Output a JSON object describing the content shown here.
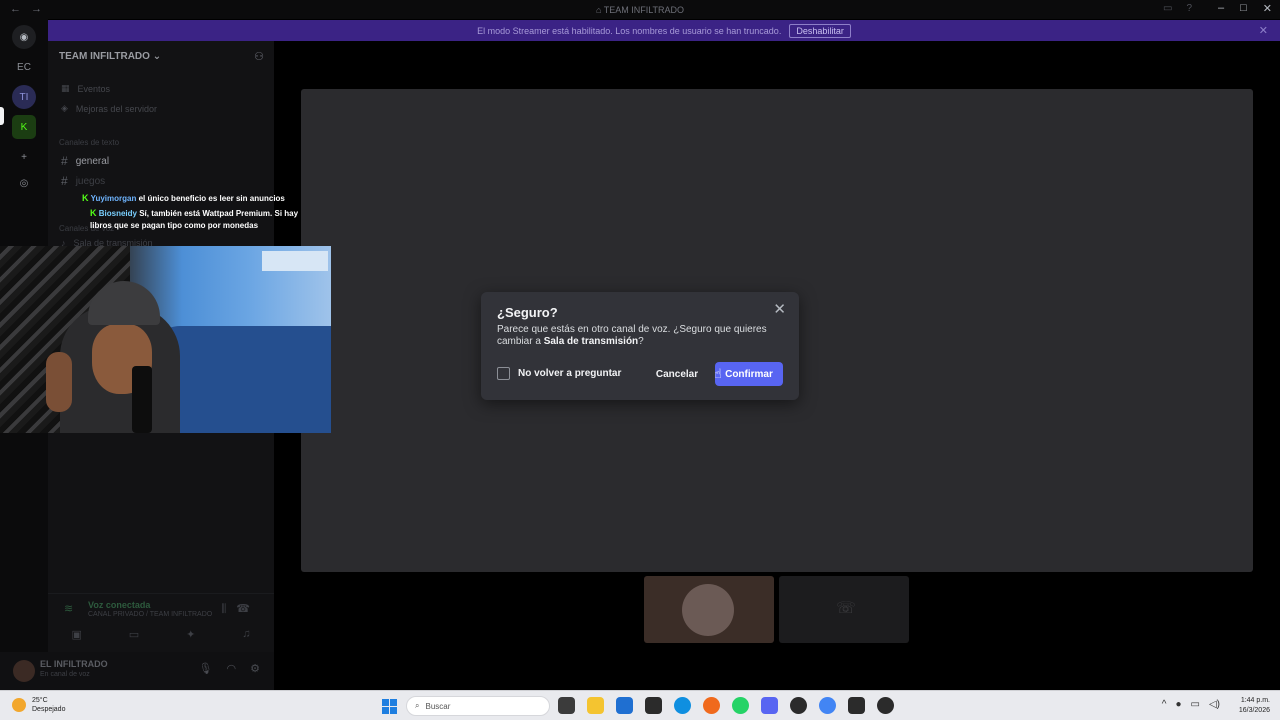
{
  "window": {
    "title": "TEAM INFILTRADO",
    "back_icon": "arrow-left-icon",
    "forward_icon": "arrow-right-icon"
  },
  "banner": {
    "message": "El modo Streamer está habilitado. Los nombres de usuario se han truncado.",
    "disable_label": "Deshabilitar"
  },
  "rail": {
    "items": [
      "EC",
      "TI"
    ]
  },
  "sidebar": {
    "server_name": "TEAM INFILTRADO",
    "items": [
      {
        "label": "Eventos"
      },
      {
        "label": "Mejoras del servidor"
      }
    ],
    "category_text": "Canales de texto",
    "channels": [
      {
        "label": "general"
      },
      {
        "label": "juegos"
      }
    ],
    "category_voice": "Canales de voz",
    "voice_channel": "Sala de transmisión"
  },
  "chat": [
    {
      "user": "Yuyimorgan",
      "text": "el único beneficio es leer sin anuncios"
    },
    {
      "user": "Biosneidy",
      "text": "Sí, también está Wattpad Premium. Si hay libros que se pagan tipo como por monedas"
    }
  ],
  "voice_panel": {
    "status": "Voz conectada",
    "channel": "CANAL PRIVADO / TEAM INFILTRADO"
  },
  "user_panel": {
    "name": "EL INFILTRADO",
    "status": "En canal de voz"
  },
  "dialog": {
    "title": "¿Seguro?",
    "body_prefix": "Parece que estás en otro canal de voz. ¿Seguro que quieres cambiar a",
    "channel_name": "Sala de transmisión",
    "body_suffix": "?",
    "checkbox_label": "No volver a preguntar",
    "cancel_label": "Cancelar",
    "confirm_label": "Confirmar"
  },
  "taskbar": {
    "temperature": "25°C",
    "weather": "Despejado",
    "search_placeholder": "Buscar",
    "time": "1:44 p.m.",
    "date": "16/3/2026",
    "app_colors": [
      "#3b3b3b",
      "#f4c430",
      "#1f6fd1",
      "#2b2b2b",
      "#0f8fe0",
      "#f06a1d",
      "#25d366",
      "#5865f2",
      "#2b2b2b",
      "#4285f4",
      "#2b2b2b",
      "#2b2b2b"
    ]
  },
  "colors": {
    "accent": "#5865f2",
    "banner": "#3b2385",
    "kick_green": "#53fc18"
  }
}
